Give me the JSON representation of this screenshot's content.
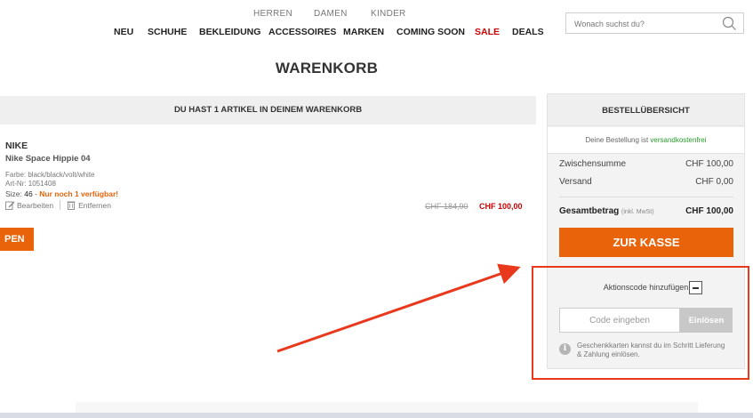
{
  "gender_nav": [
    "HERREN",
    "DAMEN",
    "KINDER"
  ],
  "main_nav": [
    "NEU",
    "SCHUHE",
    "BEKLEIDUNG",
    "ACCESSOIRES",
    "MARKEN",
    "COMING SOON",
    "SALE",
    "DEALS"
  ],
  "search": {
    "placeholder": "Wonach suchst du?",
    "icon": "search-icon"
  },
  "page_title": "WARENKORB",
  "cart_banner": "DU HAST 1 ARTIKEL IN DEINEM WARENKORB",
  "item": {
    "brand": "NIKE",
    "name": "Nike Space Hippie 04",
    "color": "Farbe: black/black/volt/white",
    "article": "Art-Nr: 1051408",
    "size_prefix": "Size: ",
    "size_value": "46",
    "size_sep": " - ",
    "stock_note": "Nur noch 1 verfügbar!",
    "edit_label": "Bearbeiten",
    "remove_label": "Entfernen",
    "old_price": "CHF 184,90",
    "new_price": "CHF 100,00"
  },
  "left_button_fragment": "PEN",
  "summary": {
    "title": "BESTELLÜBERSICHT",
    "shipping_note_prefix": "Deine Bestellung ist ",
    "shipping_note_free": "versandkostenfrei",
    "subtotal_label": "Zwischensumme",
    "subtotal_value": "CHF 100,00",
    "shipping_label": "Versand",
    "shipping_value": "CHF 0,00",
    "total_label": "Gesamtbetrag",
    "total_note": "(inkl. MwSt)",
    "total_value": "CHF 100,00",
    "checkout_label": "ZUR KASSE"
  },
  "promo": {
    "label": "Aktionscode hinzufügen",
    "input_placeholder": "Code eingeben",
    "redeem_label": "Einlösen",
    "info_text": "Geschenkkarten kannst du im Schritt Lieferung & Zahlung einlösen."
  },
  "colors": {
    "accent": "#e8630a",
    "sale": "#cc0000",
    "annotation": "#e8391d",
    "free_shipping": "#2a9d2a"
  }
}
